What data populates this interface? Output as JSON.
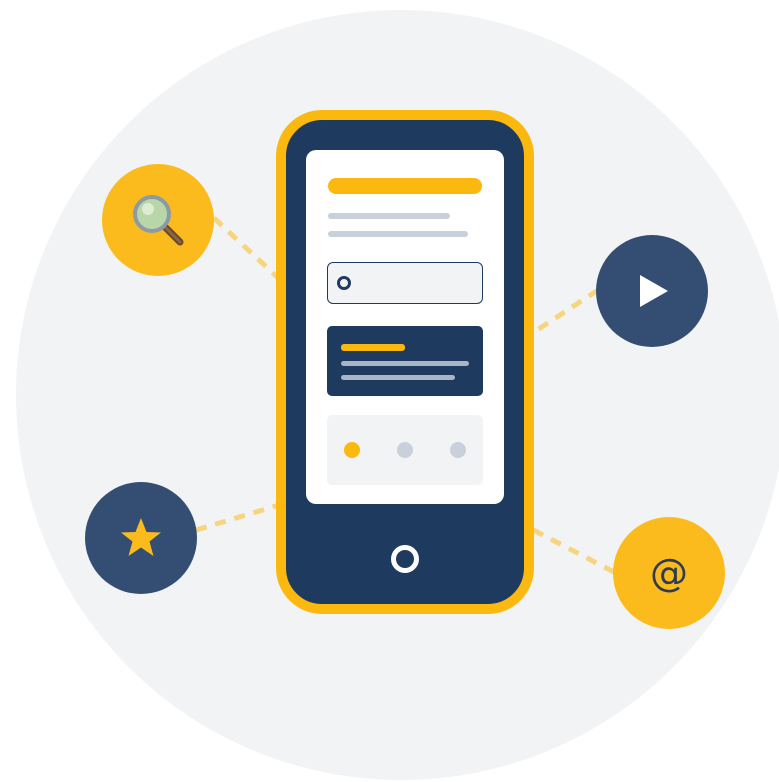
{
  "illustration": {
    "colors": {
      "accent": "#fbb90f",
      "navy": "#1f3a5f",
      "badge_navy": "#334e72",
      "background": "#f2f3f5",
      "placeholder_line": "#c8d0dc"
    },
    "phone": {
      "carousel": {
        "page_count": 3,
        "active_page": 1
      }
    },
    "badges": [
      {
        "icon": "magnifier-icon",
        "color": "yellow"
      },
      {
        "icon": "play-icon",
        "color": "navy"
      },
      {
        "icon": "star-icon",
        "color": "navy"
      },
      {
        "icon": "at-sign-icon",
        "color": "yellow",
        "glyph": "@"
      }
    ]
  }
}
